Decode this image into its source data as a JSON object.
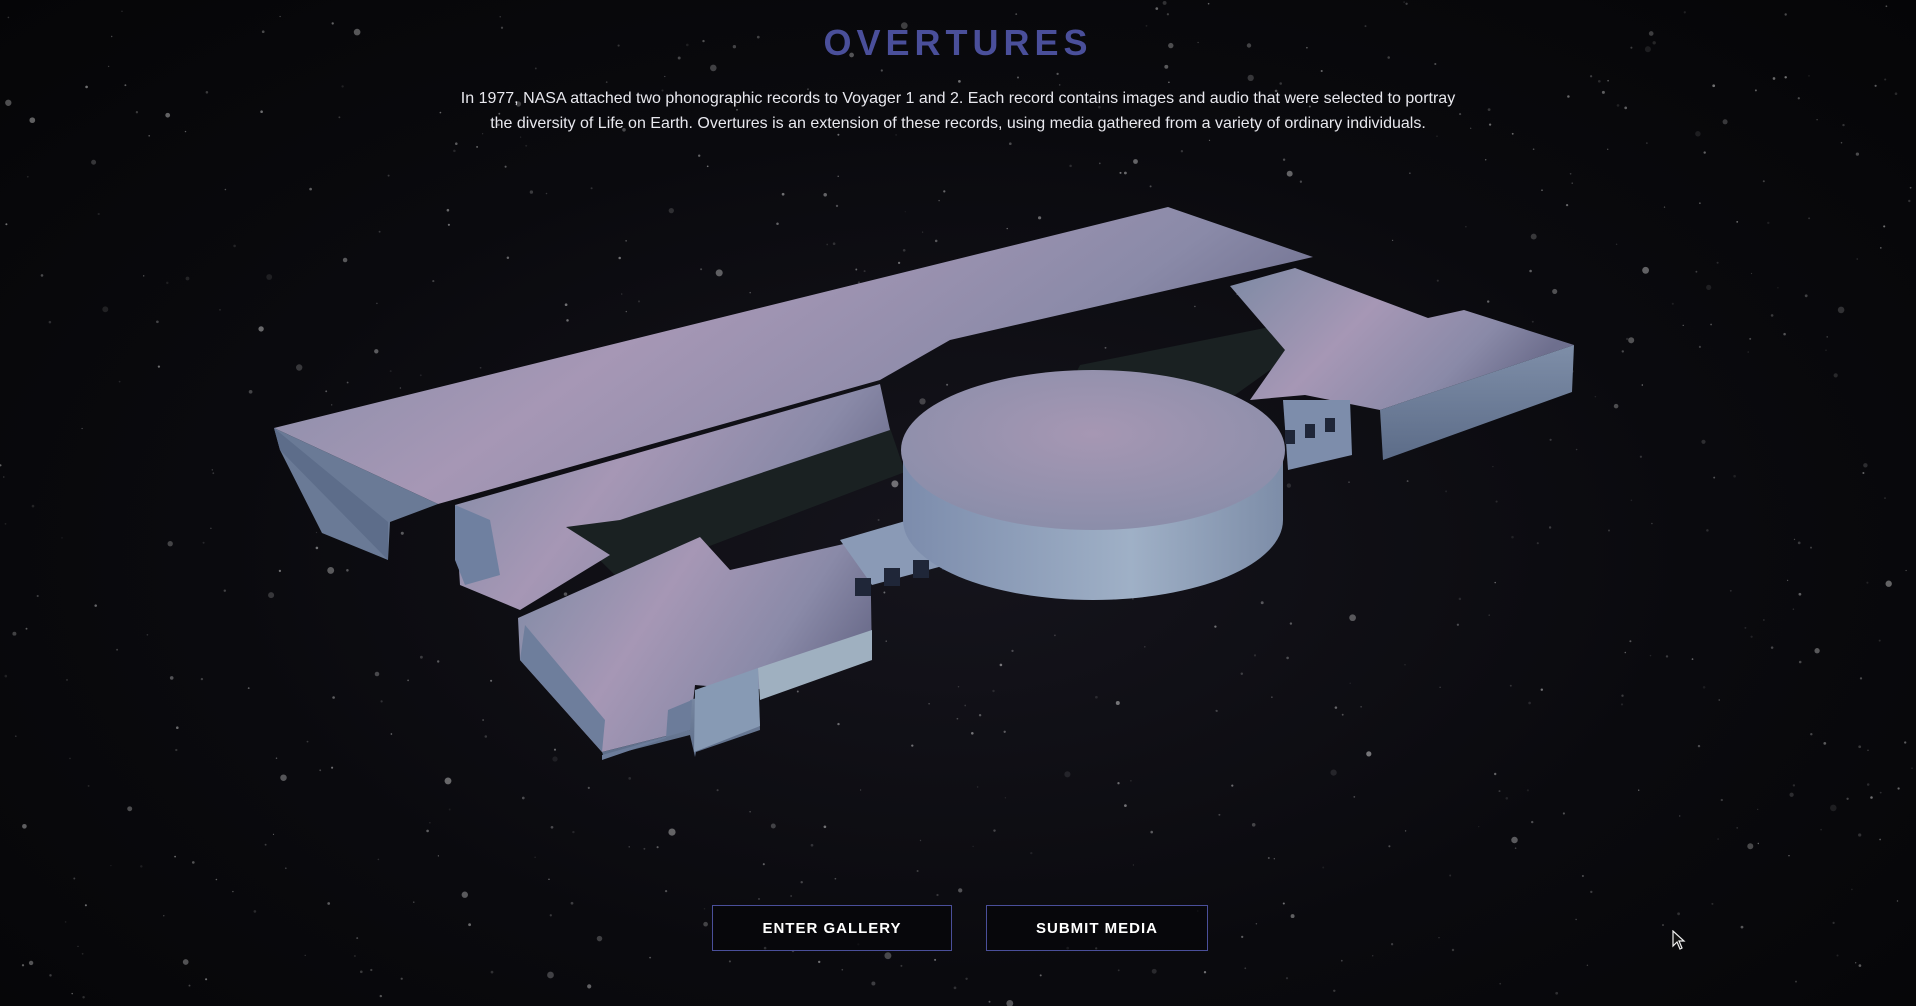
{
  "page": {
    "title": "OVERTURES",
    "intro_line1": "In 1977, NASA attached two phonographic records to Voyager 1 and 2. Each record contains images and audio that were selected to portray",
    "intro_line2": "the diversity of Life on Earth. Overtures is an extension of these records, using media gathered from a variety of ordinary individuals."
  },
  "buttons": {
    "enter_gallery": "ENTER GALLERY",
    "submit_media": "SUBMIT MEDIA"
  },
  "icons": {
    "cursor": "mouse-pointer-icon"
  },
  "colors": {
    "accent": "#4a4f9a",
    "background": "#07070a",
    "text": "#e8e8ee"
  }
}
